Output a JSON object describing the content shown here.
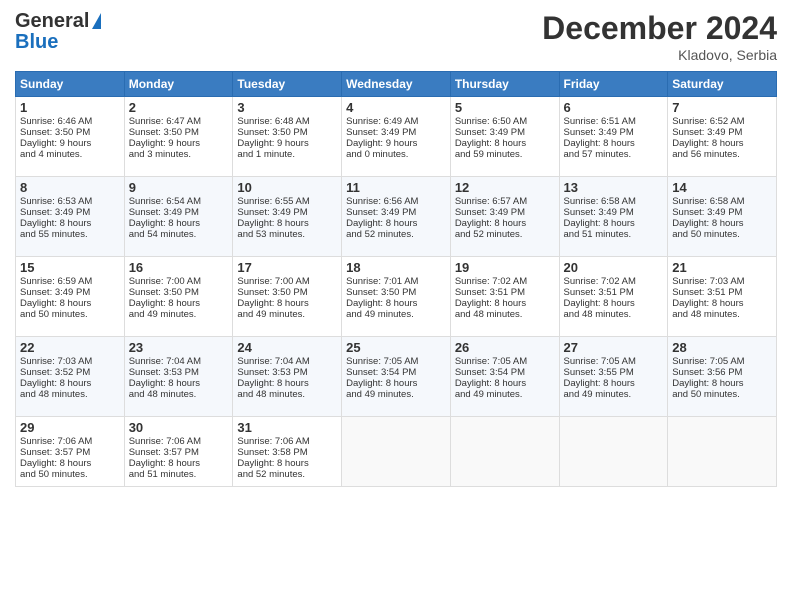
{
  "header": {
    "logo_line1": "General",
    "logo_line2": "Blue",
    "month": "December 2024",
    "location": "Kladovo, Serbia"
  },
  "days_of_week": [
    "Sunday",
    "Monday",
    "Tuesday",
    "Wednesday",
    "Thursday",
    "Friday",
    "Saturday"
  ],
  "weeks": [
    [
      {
        "day": 1,
        "lines": [
          "Sunrise: 6:46 AM",
          "Sunset: 3:50 PM",
          "Daylight: 9 hours",
          "and 4 minutes."
        ]
      },
      {
        "day": 2,
        "lines": [
          "Sunrise: 6:47 AM",
          "Sunset: 3:50 PM",
          "Daylight: 9 hours",
          "and 3 minutes."
        ]
      },
      {
        "day": 3,
        "lines": [
          "Sunrise: 6:48 AM",
          "Sunset: 3:50 PM",
          "Daylight: 9 hours",
          "and 1 minute."
        ]
      },
      {
        "day": 4,
        "lines": [
          "Sunrise: 6:49 AM",
          "Sunset: 3:49 PM",
          "Daylight: 9 hours",
          "and 0 minutes."
        ]
      },
      {
        "day": 5,
        "lines": [
          "Sunrise: 6:50 AM",
          "Sunset: 3:49 PM",
          "Daylight: 8 hours",
          "and 59 minutes."
        ]
      },
      {
        "day": 6,
        "lines": [
          "Sunrise: 6:51 AM",
          "Sunset: 3:49 PM",
          "Daylight: 8 hours",
          "and 57 minutes."
        ]
      },
      {
        "day": 7,
        "lines": [
          "Sunrise: 6:52 AM",
          "Sunset: 3:49 PM",
          "Daylight: 8 hours",
          "and 56 minutes."
        ]
      }
    ],
    [
      {
        "day": 8,
        "lines": [
          "Sunrise: 6:53 AM",
          "Sunset: 3:49 PM",
          "Daylight: 8 hours",
          "and 55 minutes."
        ]
      },
      {
        "day": 9,
        "lines": [
          "Sunrise: 6:54 AM",
          "Sunset: 3:49 PM",
          "Daylight: 8 hours",
          "and 54 minutes."
        ]
      },
      {
        "day": 10,
        "lines": [
          "Sunrise: 6:55 AM",
          "Sunset: 3:49 PM",
          "Daylight: 8 hours",
          "and 53 minutes."
        ]
      },
      {
        "day": 11,
        "lines": [
          "Sunrise: 6:56 AM",
          "Sunset: 3:49 PM",
          "Daylight: 8 hours",
          "and 52 minutes."
        ]
      },
      {
        "day": 12,
        "lines": [
          "Sunrise: 6:57 AM",
          "Sunset: 3:49 PM",
          "Daylight: 8 hours",
          "and 52 minutes."
        ]
      },
      {
        "day": 13,
        "lines": [
          "Sunrise: 6:58 AM",
          "Sunset: 3:49 PM",
          "Daylight: 8 hours",
          "and 51 minutes."
        ]
      },
      {
        "day": 14,
        "lines": [
          "Sunrise: 6:58 AM",
          "Sunset: 3:49 PM",
          "Daylight: 8 hours",
          "and 50 minutes."
        ]
      }
    ],
    [
      {
        "day": 15,
        "lines": [
          "Sunrise: 6:59 AM",
          "Sunset: 3:49 PM",
          "Daylight: 8 hours",
          "and 50 minutes."
        ]
      },
      {
        "day": 16,
        "lines": [
          "Sunrise: 7:00 AM",
          "Sunset: 3:50 PM",
          "Daylight: 8 hours",
          "and 49 minutes."
        ]
      },
      {
        "day": 17,
        "lines": [
          "Sunrise: 7:00 AM",
          "Sunset: 3:50 PM",
          "Daylight: 8 hours",
          "and 49 minutes."
        ]
      },
      {
        "day": 18,
        "lines": [
          "Sunrise: 7:01 AM",
          "Sunset: 3:50 PM",
          "Daylight: 8 hours",
          "and 49 minutes."
        ]
      },
      {
        "day": 19,
        "lines": [
          "Sunrise: 7:02 AM",
          "Sunset: 3:51 PM",
          "Daylight: 8 hours",
          "and 48 minutes."
        ]
      },
      {
        "day": 20,
        "lines": [
          "Sunrise: 7:02 AM",
          "Sunset: 3:51 PM",
          "Daylight: 8 hours",
          "and 48 minutes."
        ]
      },
      {
        "day": 21,
        "lines": [
          "Sunrise: 7:03 AM",
          "Sunset: 3:51 PM",
          "Daylight: 8 hours",
          "and 48 minutes."
        ]
      }
    ],
    [
      {
        "day": 22,
        "lines": [
          "Sunrise: 7:03 AM",
          "Sunset: 3:52 PM",
          "Daylight: 8 hours",
          "and 48 minutes."
        ]
      },
      {
        "day": 23,
        "lines": [
          "Sunrise: 7:04 AM",
          "Sunset: 3:53 PM",
          "Daylight: 8 hours",
          "and 48 minutes."
        ]
      },
      {
        "day": 24,
        "lines": [
          "Sunrise: 7:04 AM",
          "Sunset: 3:53 PM",
          "Daylight: 8 hours",
          "and 48 minutes."
        ]
      },
      {
        "day": 25,
        "lines": [
          "Sunrise: 7:05 AM",
          "Sunset: 3:54 PM",
          "Daylight: 8 hours",
          "and 49 minutes."
        ]
      },
      {
        "day": 26,
        "lines": [
          "Sunrise: 7:05 AM",
          "Sunset: 3:54 PM",
          "Daylight: 8 hours",
          "and 49 minutes."
        ]
      },
      {
        "day": 27,
        "lines": [
          "Sunrise: 7:05 AM",
          "Sunset: 3:55 PM",
          "Daylight: 8 hours",
          "and 49 minutes."
        ]
      },
      {
        "day": 28,
        "lines": [
          "Sunrise: 7:05 AM",
          "Sunset: 3:56 PM",
          "Daylight: 8 hours",
          "and 50 minutes."
        ]
      }
    ],
    [
      {
        "day": 29,
        "lines": [
          "Sunrise: 7:06 AM",
          "Sunset: 3:57 PM",
          "Daylight: 8 hours",
          "and 50 minutes."
        ]
      },
      {
        "day": 30,
        "lines": [
          "Sunrise: 7:06 AM",
          "Sunset: 3:57 PM",
          "Daylight: 8 hours",
          "and 51 minutes."
        ]
      },
      {
        "day": 31,
        "lines": [
          "Sunrise: 7:06 AM",
          "Sunset: 3:58 PM",
          "Daylight: 8 hours",
          "and 52 minutes."
        ]
      },
      null,
      null,
      null,
      null
    ]
  ]
}
